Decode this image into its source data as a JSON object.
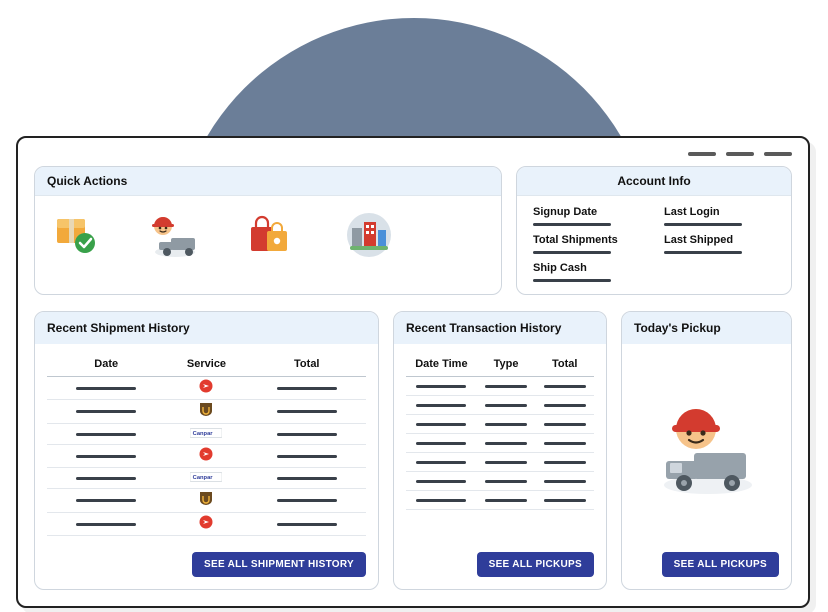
{
  "quick_actions": {
    "title": "Quick Actions"
  },
  "account": {
    "title": "Account Info",
    "items": [
      {
        "label": "Signup Date"
      },
      {
        "label": "Last Login"
      },
      {
        "label": "Total Shipments"
      },
      {
        "label": "Last Shipped"
      },
      {
        "label": "Ship Cash"
      }
    ]
  },
  "shipment": {
    "title": "Recent Shipment History",
    "cols": {
      "date": "Date",
      "service": "Service",
      "total": "Total"
    },
    "rows": [
      {
        "service": "puro"
      },
      {
        "service": "ups"
      },
      {
        "service": "canpar"
      },
      {
        "service": "puro"
      },
      {
        "service": "canpar"
      },
      {
        "service": "ups"
      },
      {
        "service": "puro"
      }
    ],
    "cta": "SEE ALL SHIPMENT HISTORY"
  },
  "transaction": {
    "title": "Recent Transaction History",
    "cols": {
      "datetime": "Date Time",
      "type": "Type",
      "total": "Total"
    },
    "row_count": 7,
    "cta": "SEE ALL PICKUPS"
  },
  "pickup": {
    "title": "Today's Pickup",
    "cta": "SEE ALL PICKUPS"
  }
}
